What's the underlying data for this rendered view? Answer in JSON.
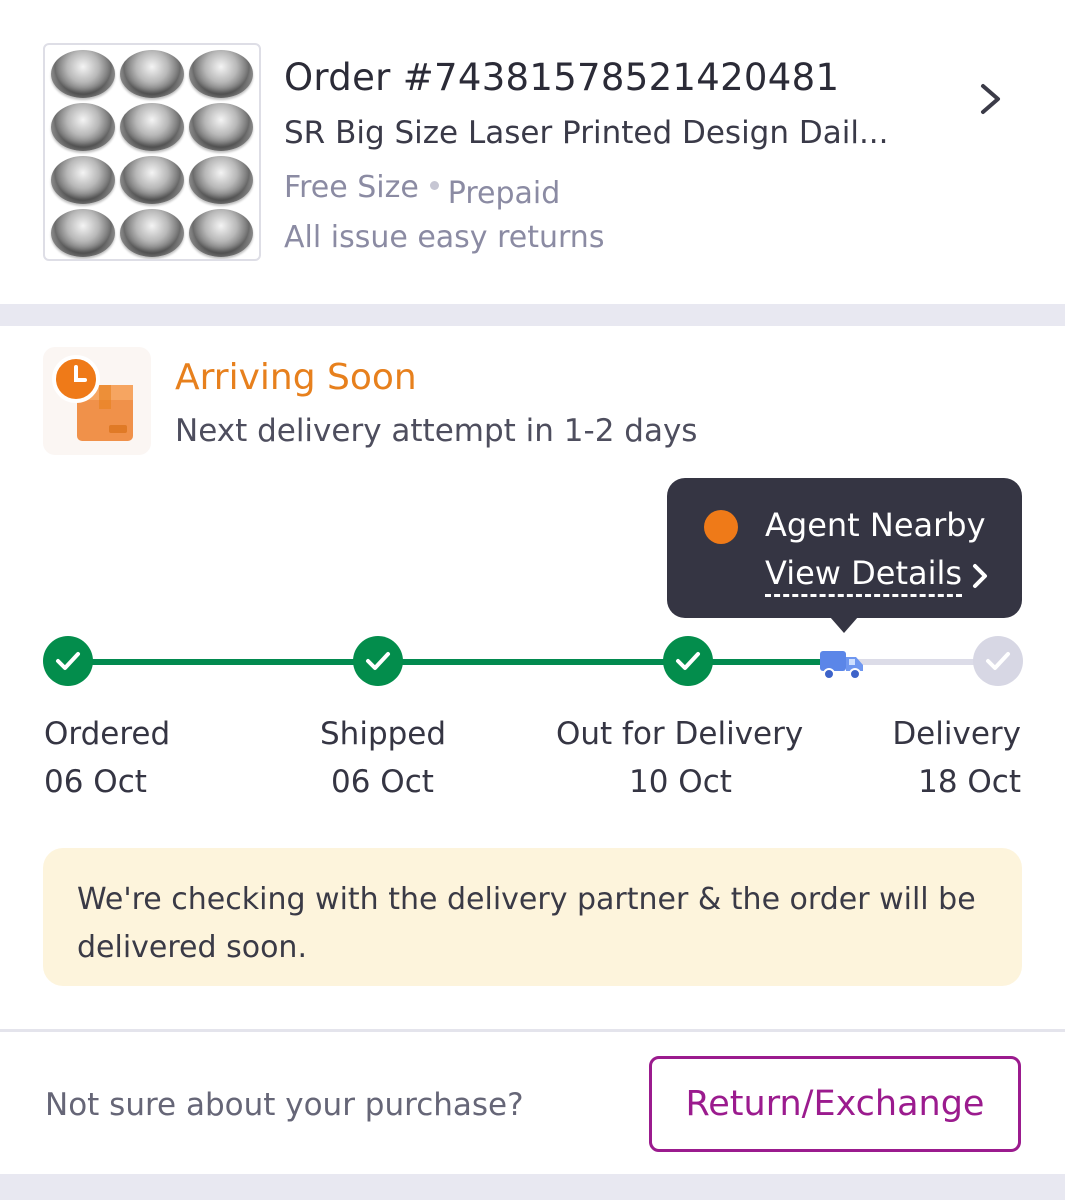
{
  "order": {
    "title": "Order #74381578521420481",
    "product_name": "SR  Big Size Laser Printed Design Dail...",
    "size": "Free Size",
    "payment": "Prepaid",
    "returns_policy": "All issue easy returns"
  },
  "status": {
    "title": "Arriving Soon",
    "subtitle": "Next delivery attempt in 1-2 days",
    "title_color": "#e7801d"
  },
  "tooltip": {
    "title": "Agent Nearby",
    "link": "View Details"
  },
  "timeline": {
    "steps": [
      {
        "label": "Ordered",
        "date": "06 Oct",
        "state": "done"
      },
      {
        "label": "Shipped",
        "date": "06 Oct",
        "state": "done"
      },
      {
        "label": "Out for Delivery",
        "date": "10 Oct",
        "state": "done"
      },
      {
        "label": "Delivery",
        "date": "18 Oct",
        "state": "pending"
      }
    ],
    "done_color": "#038d4c",
    "pending_color": "#d7d7e4",
    "current_icon": "truck-icon"
  },
  "info_banner": {
    "text": "We're checking with the delivery partner & the order will be delivered soon."
  },
  "footer": {
    "question": "Not sure about your purchase?",
    "button_label": "Return/Exchange",
    "accent": "#9b1b8e"
  }
}
